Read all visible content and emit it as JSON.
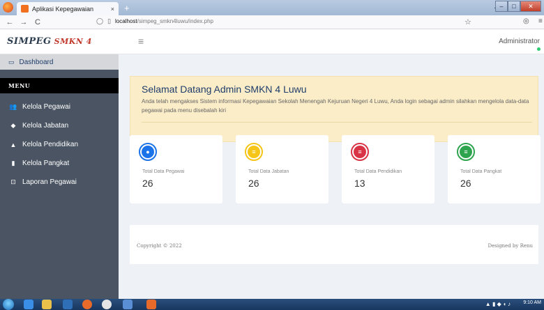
{
  "browser": {
    "tab_title": "Aplikasi Kepegawaian",
    "tab_close": "×",
    "new_tab": "+",
    "tab_dropdown": "⌄",
    "url_host": "localhost",
    "url_path": "/simpeg_smkn4luwu/index.php",
    "back": "←",
    "forward": "→",
    "reload": "C"
  },
  "header": {
    "logo": "SIMPEG",
    "logo_sub": "SMKN 4",
    "user": "Administrator",
    "menu_toggle": "≡"
  },
  "sidebar": {
    "dashboard": "Dashboard",
    "menu_heading": "MENU",
    "items": [
      {
        "label": "Kelola Pegawai",
        "icon": "users-icon"
      },
      {
        "label": "Kelola Jabatan",
        "icon": "tag-icon"
      },
      {
        "label": "Kelola Pendidikan",
        "icon": "graduation-cap-icon"
      },
      {
        "label": "Kelola Pangkat",
        "icon": "bookmark-icon"
      },
      {
        "label": "Laporan Pegawai",
        "icon": "report-icon"
      }
    ]
  },
  "welcome": {
    "title": "Selamat Datang Admin SMKN 4 Luwu",
    "text": "Anda telah mengakses Sistem informasi Kepegawaian Sekolah Menengah Kejuruan Negeri 4 Luwu, Anda login sebagai admin silahkan mengelola data-data pegawai pada menu disebalah kiri"
  },
  "cards": [
    {
      "label": "Total Data Pegawai",
      "value": "26",
      "color": "#1a73e8",
      "icon": "user-icon"
    },
    {
      "label": "Total Data Jabatan",
      "value": "26",
      "color": "#f5c518",
      "icon": "database-icon"
    },
    {
      "label": "Total Data Pendidikan",
      "value": "13",
      "color": "#d93445",
      "icon": "database-icon"
    },
    {
      "label": "Total Data Pangkat",
      "value": "26",
      "color": "#2ea44f",
      "icon": "database-icon"
    }
  ],
  "footer": {
    "copyright": "Copyright © 2022",
    "designed": "Designed by Renu"
  },
  "taskbar": {
    "time": "9:10 AM"
  }
}
